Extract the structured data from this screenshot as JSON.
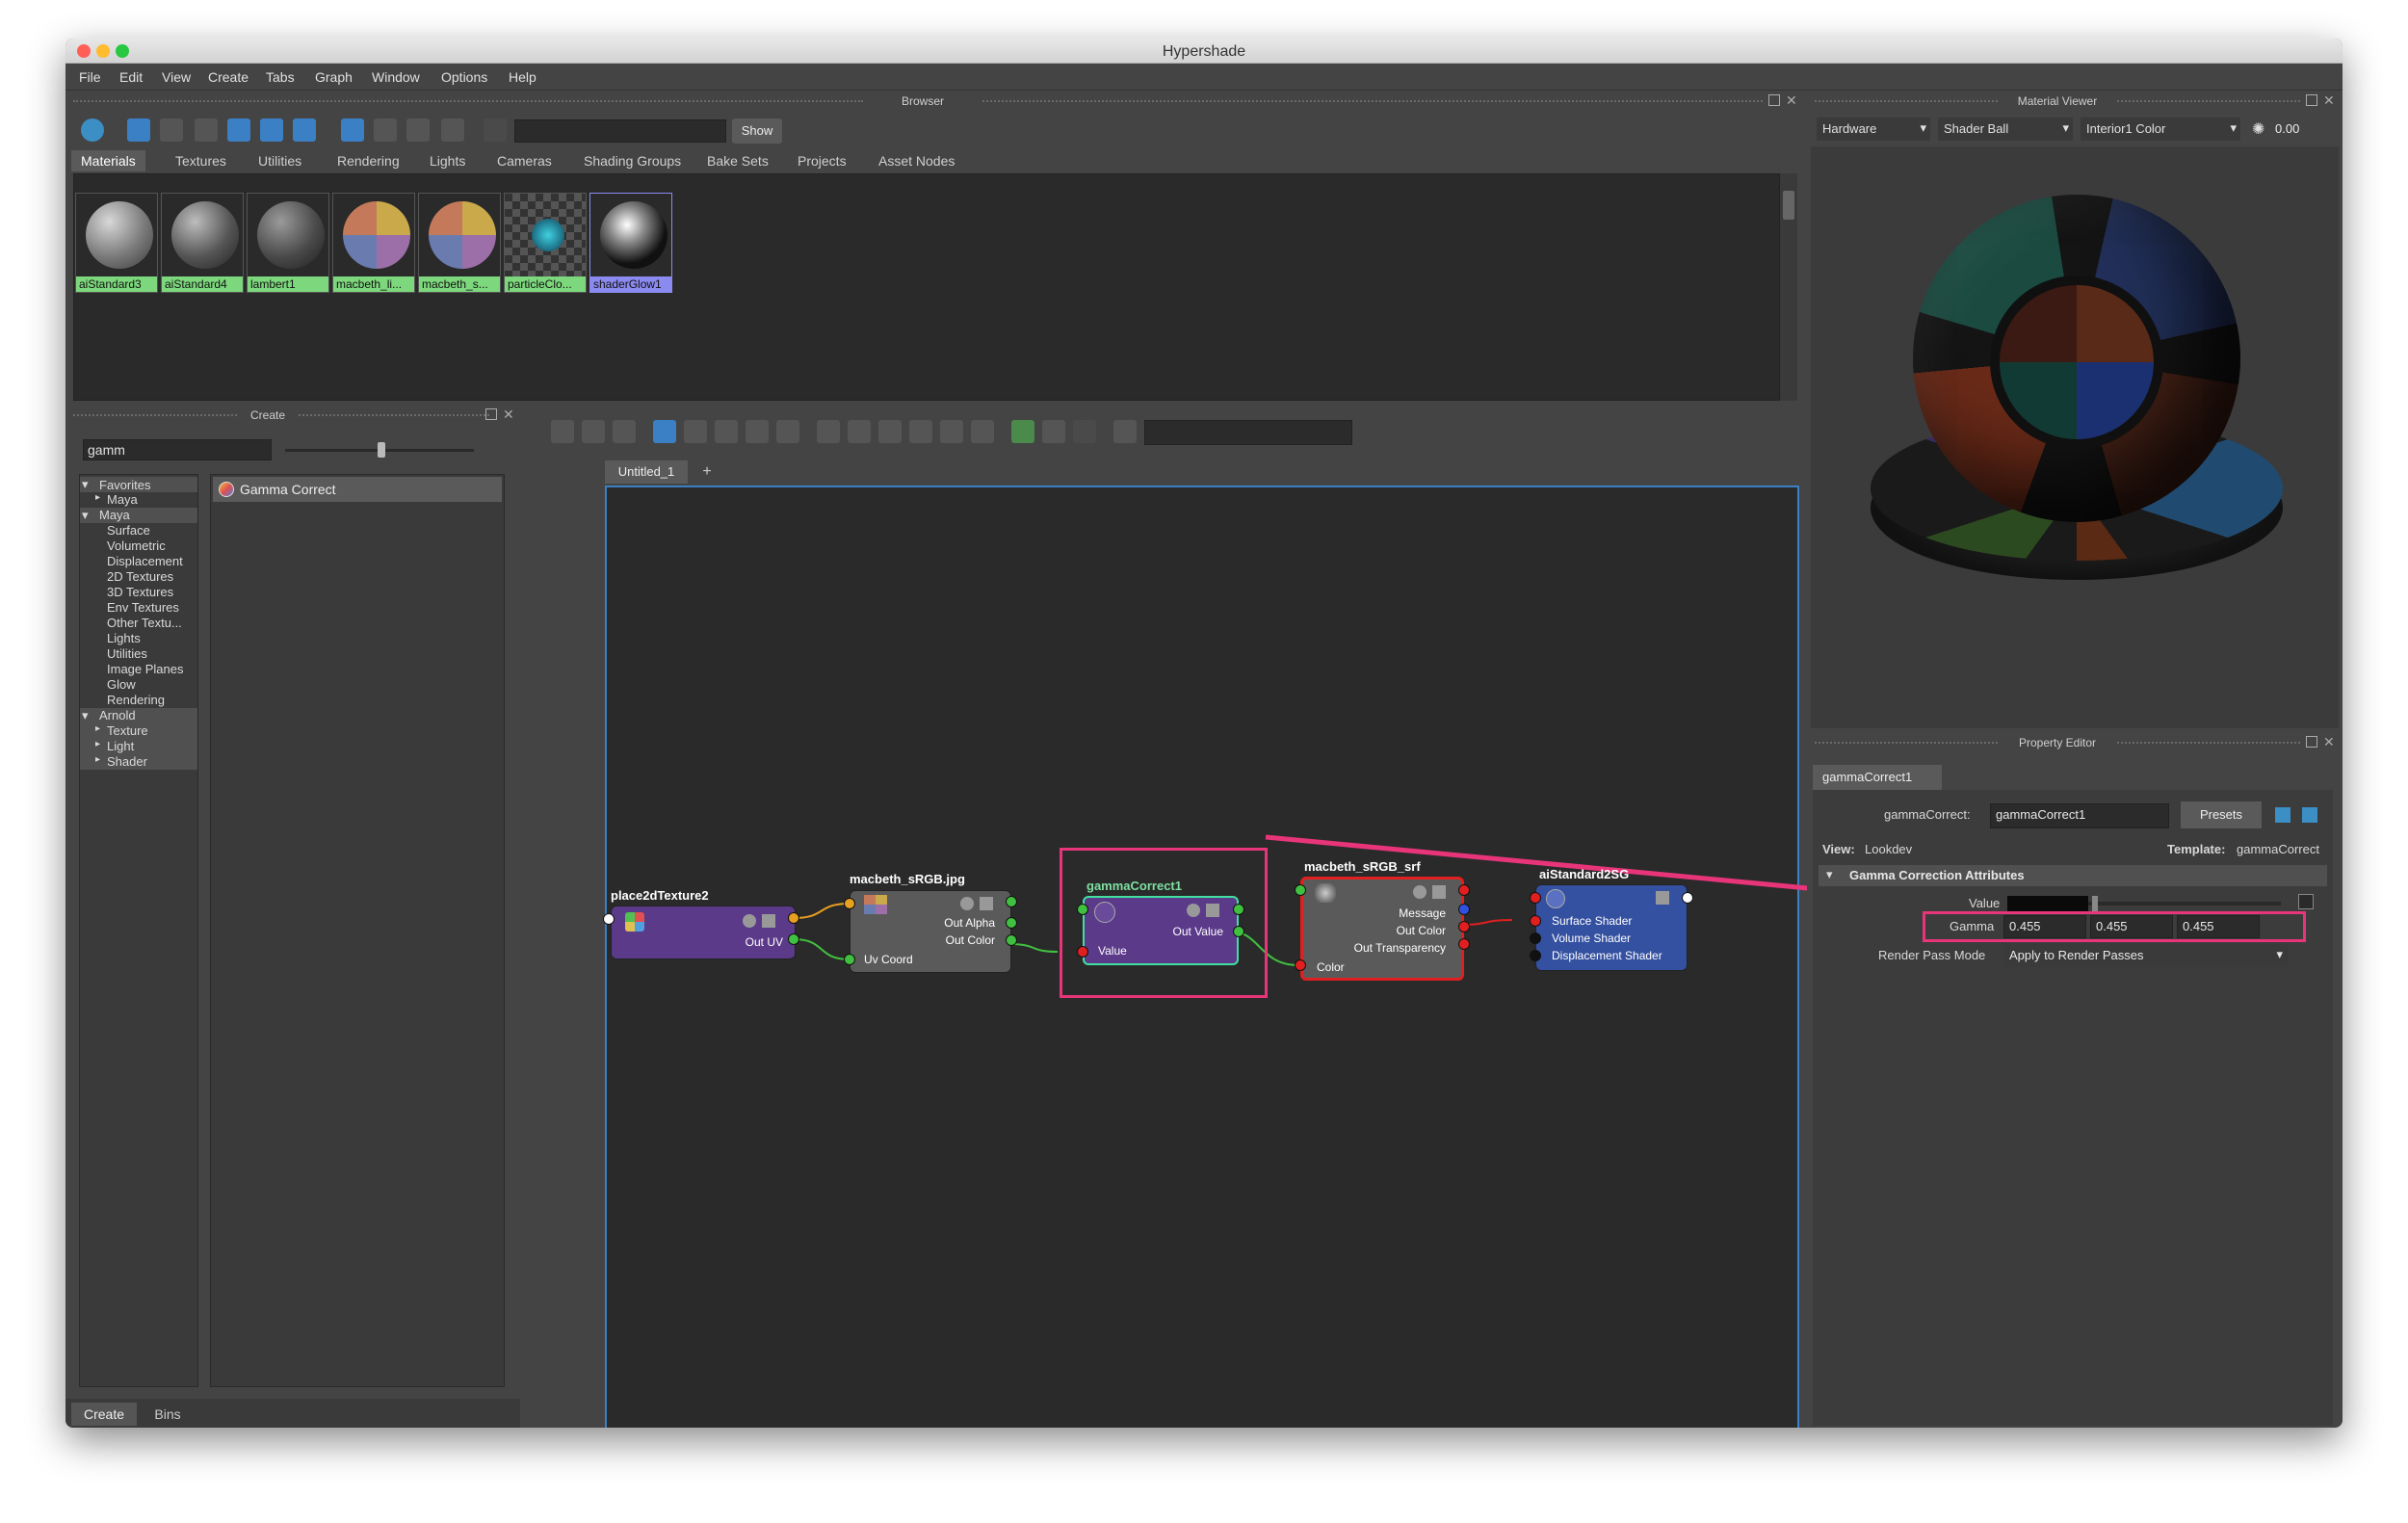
{
  "window": {
    "title": "Hypershade"
  },
  "menu": [
    "File",
    "Edit",
    "View",
    "Create",
    "Tabs",
    "Graph",
    "Window",
    "Options",
    "Help"
  ],
  "browser": {
    "header": "Browser",
    "show_label": "Show",
    "search_value": "",
    "tabs": [
      "Materials",
      "Textures",
      "Utilities",
      "Rendering",
      "Lights",
      "Cameras",
      "Shading Groups",
      "Bake Sets",
      "Projects",
      "Asset Nodes"
    ],
    "materials": [
      "aiStandard3",
      "aiStandard4",
      "lambert1",
      "macbeth_li...",
      "macbeth_s...",
      "particleClo...",
      "shaderGlow1"
    ]
  },
  "create_panel": {
    "header": "Create",
    "search_value": "gamm",
    "tree": [
      "Favorites",
      "Maya",
      "Maya",
      "Surface",
      "Volumetric",
      "Displacement",
      "2D Textures",
      "3D Textures",
      "Env Textures",
      "Other Textu...",
      "Lights",
      "Utilities",
      "Image Planes",
      "Glow",
      "Rendering",
      "Arnold",
      "Texture",
      "Light",
      "Shader"
    ],
    "result": "Gamma Correct",
    "bottom_tabs": [
      "Create",
      "Bins"
    ]
  },
  "graph": {
    "tab": "Untitled_1",
    "add_tab": "+",
    "nodes": {
      "place2d": {
        "title": "place2dTexture2",
        "ports": [
          "Out UV"
        ]
      },
      "file": {
        "title": "macbeth_sRGB.jpg",
        "ports": [
          "Out Alpha",
          "Out Color",
          "Uv Coord"
        ]
      },
      "gamma": {
        "title": "gammaCorrect1",
        "ports": [
          "Out Value",
          "Value"
        ]
      },
      "surface": {
        "title": "macbeth_sRGB_srf",
        "ports": [
          "Message",
          "Out Color",
          "Out Transparency",
          "Color"
        ]
      },
      "sg": {
        "title": "aiStandard2SG",
        "ports": [
          "Surface Shader",
          "Volume Shader",
          "Displacement Shader"
        ]
      }
    }
  },
  "material_viewer": {
    "header": "Material Viewer",
    "renderer": "Hardware",
    "geometry": "Shader Ball",
    "environment": "Interior1 Color",
    "exposure": "0.00"
  },
  "property_editor": {
    "header": "Property Editor",
    "tab": "gammaCorrect1",
    "node_label": "gammaCorrect:",
    "node_value": "gammaCorrect1",
    "presets_label": "Presets",
    "view_label": "View:",
    "view_value": "Lookdev",
    "template_label": "Template:",
    "template_value": "gammaCorrect",
    "section": "Gamma Correction Attributes",
    "value_label": "Value",
    "gamma_label": "Gamma",
    "gamma_values": [
      "0.455",
      "0.455",
      "0.455"
    ],
    "render_pass_label": "Render Pass Mode",
    "render_pass_value": "Apply to Render Passes"
  },
  "colors": {
    "accent_green": "#7dd87d",
    "highlight_pink": "#e8357a",
    "node_purple": "#5b3a8a",
    "node_blue": "#3450a0",
    "node_gray": "#5a5a5a",
    "node_red_border": "#e02020",
    "selection_blue": "#3b7fc4"
  }
}
